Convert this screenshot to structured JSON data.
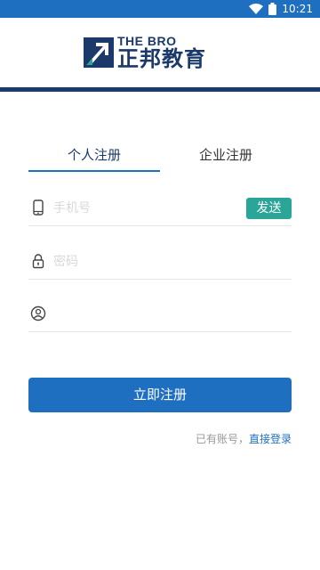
{
  "status_bar": {
    "time": "10:21",
    "background": "#1f6fc1"
  },
  "header": {
    "logo_en": "THE BRO",
    "logo_cn": "正邦教育",
    "brand_color": "#1b3a6b"
  },
  "tabs": [
    {
      "label": "个人注册",
      "active": true
    },
    {
      "label": "企业注册",
      "active": false
    }
  ],
  "form": {
    "phone": {
      "icon": "phone-icon",
      "placeholder": "手机号",
      "value": ""
    },
    "send_label": "发送",
    "password": {
      "icon": "lock-icon",
      "placeholder": "密码",
      "value": ""
    },
    "invite": {
      "icon": "user-circle-icon",
      "placeholder": "",
      "value": ""
    }
  },
  "register_label": "立即注册",
  "login_prompt": {
    "text": "已有账号，",
    "link": "直接登录"
  },
  "colors": {
    "accent": "#1f6fc1",
    "send": "#2aa597"
  }
}
